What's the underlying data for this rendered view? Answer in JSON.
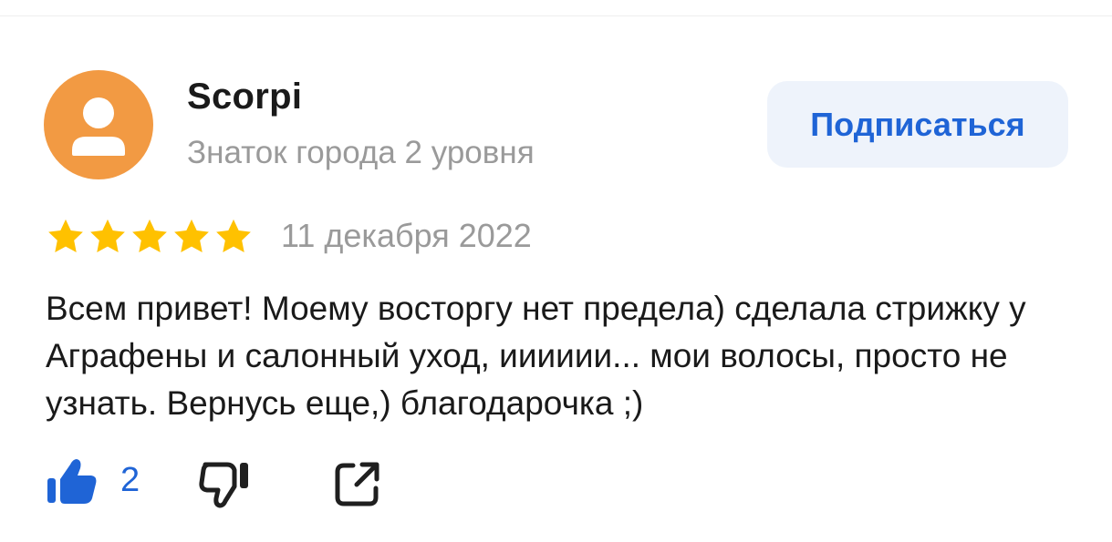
{
  "author": {
    "name": "Scorpi",
    "status": "Знаток города 2 уровня",
    "avatar_color": "#f29a43"
  },
  "subscribe": {
    "label": "Подписаться"
  },
  "review": {
    "rating": 5,
    "rating_max": 5,
    "date": "11 декабря 2022",
    "text": "Всем привет! Моему восторгу нет предела) сделала стрижку у Аграфены и салонный уход,  ииииии... мои волосы,  просто не узнать. Вернусь еще,)  благодарочка ;)"
  },
  "actions": {
    "like_count": "2",
    "like_icon": "thumbs-up-icon",
    "dislike_icon": "thumbs-down-icon",
    "share_icon": "share-icon"
  },
  "colors": {
    "accent": "#1f64d6",
    "star": "#ffc100",
    "muted_text": "#9a9a9a",
    "button_bg": "#eef3fb"
  }
}
